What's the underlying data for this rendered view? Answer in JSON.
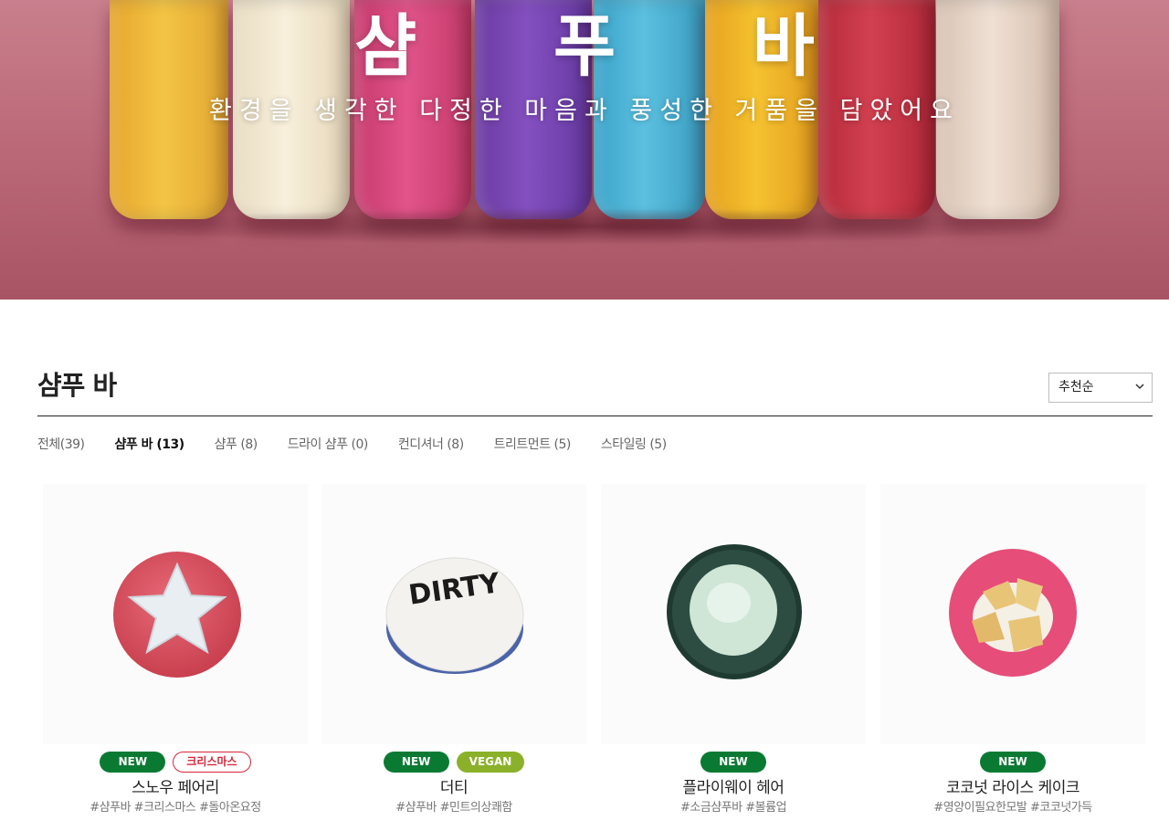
{
  "hero": {
    "title": "샴 푸 바",
    "subtitle": "환경을 생각한 다정한 마음과 풍성한 거품을 담았어요"
  },
  "section": {
    "title": "샴푸 바",
    "sort_value": "추천순"
  },
  "tabs": [
    {
      "label": "전체(39)",
      "active": false
    },
    {
      "label": "샴푸 바 (13)",
      "active": true
    },
    {
      "label": "샴푸 (8)",
      "active": false
    },
    {
      "label": "드라이 샴푸 (0)",
      "active": false
    },
    {
      "label": "컨디셔너 (8)",
      "active": false
    },
    {
      "label": "트리트먼트 (5)",
      "active": false
    },
    {
      "label": "스타일링 (5)",
      "active": false
    }
  ],
  "products": [
    {
      "name": "스노우 페어리",
      "tags": "#샴푸바 #크리스마스 #돌아온요정",
      "badges": [
        "NEW",
        "크리스마스"
      ],
      "image_icon": "pink-star-shampoo-bar-icon"
    },
    {
      "name": "더티",
      "tags": "#샴푸바 #민트의상쾌함",
      "badges": [
        "NEW",
        "VEGAN"
      ],
      "image_icon": "white-dirty-shampoo-bar-icon"
    },
    {
      "name": "플라이웨이 헤어",
      "tags": "#소금샴푸바 #볼륨업",
      "badges": [
        "NEW"
      ],
      "image_icon": "green-shampoo-bar-icon"
    },
    {
      "name": "코코넛 라이스 케이크",
      "tags": "#영양이필요한모발 #코코넛가득",
      "badges": [
        "NEW"
      ],
      "image_icon": "pink-flower-shampoo-bar-icon"
    }
  ],
  "colors": {
    "badge_new": "#0a7a33",
    "badge_vegan": "#8bb12a",
    "badge_xmas": "#d8263a",
    "hero_bg": "#b96676"
  }
}
